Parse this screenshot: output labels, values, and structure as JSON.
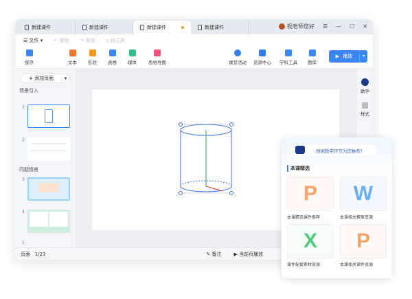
{
  "tabs": [
    {
      "label": "新建课件"
    },
    {
      "label": "新建课件"
    },
    {
      "label": "新建课件",
      "active": true,
      "unsaved": true
    },
    {
      "label": "新建课件"
    }
  ],
  "user": {
    "greeting": "祝老师您好"
  },
  "menu": {
    "file": "文件",
    "undo": "撤销",
    "redo": "重做",
    "format_painter": "格式刷"
  },
  "toolbar": {
    "save": "保存",
    "text": "文本",
    "shape": "形状",
    "table": "表格",
    "media": "媒体",
    "mindmap": "思维导图",
    "activity": "课堂活动",
    "resources": "资源中心",
    "tools": "学科工具",
    "questions": "题库",
    "play": "播放"
  },
  "sidebar": {
    "add_page": "添加页面",
    "section1": "情景引入",
    "section2": "问题情景",
    "pages": [
      "1",
      "2",
      "3",
      "4",
      "5"
    ]
  },
  "right": {
    "assistant": "助手",
    "style": "样式"
  },
  "status": {
    "page_label": "页面",
    "page": "1/23",
    "notes": "备注",
    "play_current": "当前页播放"
  },
  "panel": {
    "prompt": "根据教学环节为您推荐！",
    "title": "本课精选",
    "cards": [
      {
        "letter": "P",
        "label": "本课精选课件推荐",
        "color": "#f5a46a"
      },
      {
        "letter": "W",
        "label": "本课相关教案资源",
        "color": "#6aaef7"
      },
      {
        "letter": "X",
        "label": "课件配套素材资源",
        "color": "#4fcf7a"
      },
      {
        "letter": "P",
        "label": "本课相关课件资源",
        "color": "#f5a46a"
      }
    ]
  }
}
